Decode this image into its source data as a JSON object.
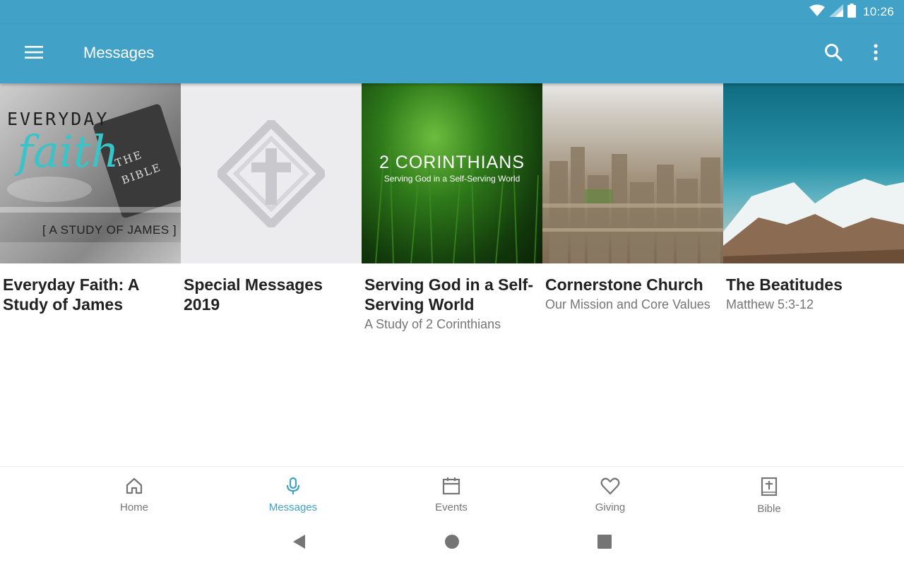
{
  "status_bar": {
    "time": "10:26"
  },
  "app_bar": {
    "title": "Messages"
  },
  "messages": [
    {
      "title": "Everyday Faith: A Study of James",
      "subtitle": "",
      "art": {
        "line1": "EVERYDAY",
        "line2": "faith",
        "book": "THE BIBLE",
        "caption": "[ A STUDY OF JAMES ]"
      }
    },
    {
      "title": "Special Messages 2019",
      "subtitle": "",
      "art": {}
    },
    {
      "title": "Serving God in a Self-Serving World",
      "subtitle": "A Study of 2 Corinthians",
      "art": {
        "heading": "2 CORINTHIANS",
        "tagline": "Serving God in a Self-Serving World"
      }
    },
    {
      "title": "Cornerstone Church",
      "subtitle": "Our Mission and Core Values",
      "art": {}
    },
    {
      "title": "The Beatitudes",
      "subtitle": "Matthew 5:3-12",
      "art": {}
    }
  ],
  "bottom_nav": [
    {
      "label": "Home",
      "icon": "home-icon",
      "active": false
    },
    {
      "label": "Messages",
      "icon": "microphone-icon",
      "active": true
    },
    {
      "label": "Events",
      "icon": "calendar-icon",
      "active": false
    },
    {
      "label": "Giving",
      "icon": "heart-icon",
      "active": false
    },
    {
      "label": "Bible",
      "icon": "bible-icon",
      "active": false
    }
  ],
  "colors": {
    "primary": "#41a1c6",
    "inactive": "#757575",
    "title_text": "#212121"
  }
}
